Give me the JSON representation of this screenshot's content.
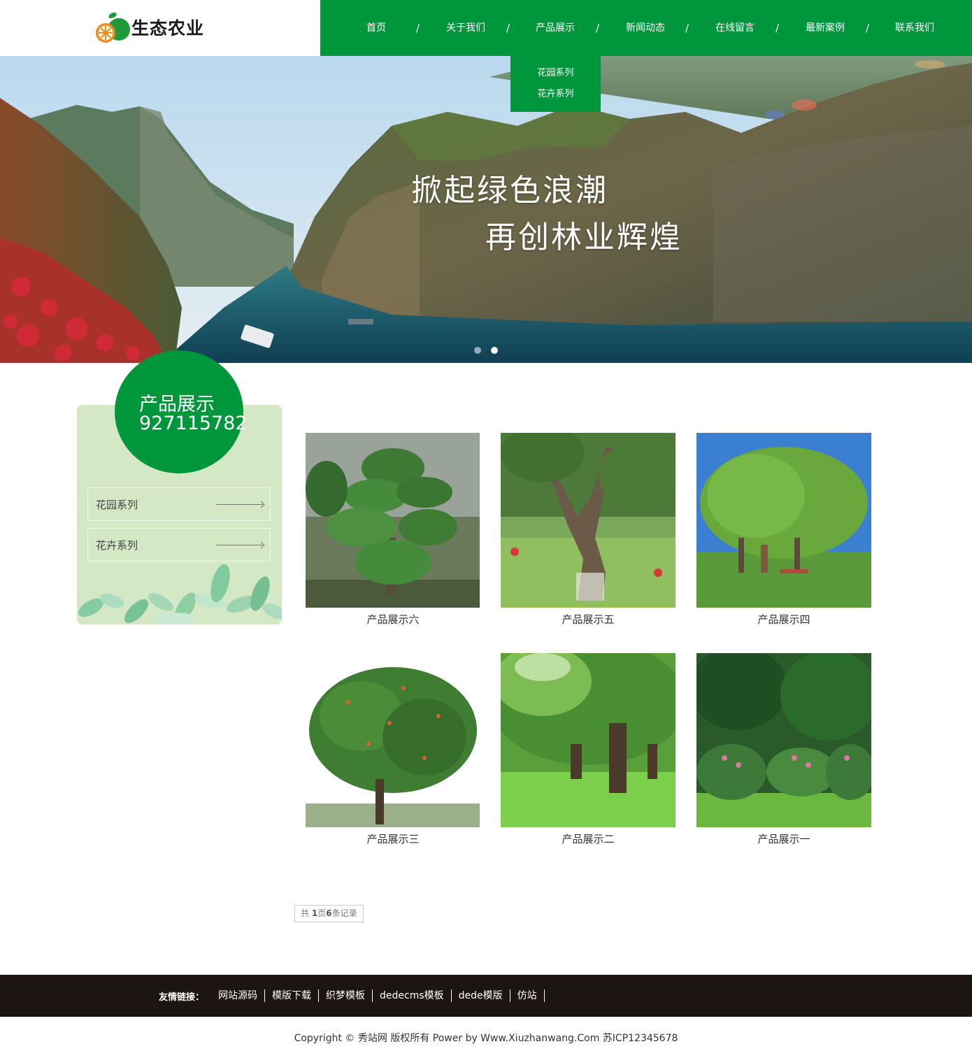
{
  "brand": {
    "name": "生态农业"
  },
  "nav": {
    "items": [
      "首页",
      "关于我们",
      "产品展示",
      "新闻动态",
      "在线留言",
      "最新案例",
      "联系我们"
    ],
    "separator": "/"
  },
  "dropdown": {
    "items": [
      "花园系列",
      "花卉系列"
    ]
  },
  "banner": {
    "line1": "掀起绿色浪潮",
    "line2": "再创林业辉煌",
    "slide_count": 2,
    "active_slide": 2
  },
  "sidebar": {
    "title": "产品展示",
    "phone": "927115782",
    "categories": [
      "花园系列",
      "花卉系列"
    ]
  },
  "products": [
    {
      "name": "产品展示六"
    },
    {
      "name": "产品展示五"
    },
    {
      "name": "产品展示四"
    },
    {
      "name": "产品展示三"
    },
    {
      "name": "产品展示二"
    },
    {
      "name": "产品展示一"
    }
  ],
  "pager": {
    "prefix": "共 ",
    "pages": "1",
    "mid": "页",
    "records": "6",
    "suffix": "条记录"
  },
  "footer": {
    "links_label": "友情链接：",
    "links": [
      "网站源码",
      "模版下载",
      "织梦模板",
      "dedecms模板",
      "dede模版",
      "仿站"
    ],
    "copyright": "Copyright © 秀站网 版权所有 Power by Www.Xiuzhanwang.Com    苏ICP12345678"
  },
  "colors": {
    "primary": "#00963c",
    "sidebar_bg": "#d5e8c6",
    "footer_bg": "#1d1512"
  }
}
